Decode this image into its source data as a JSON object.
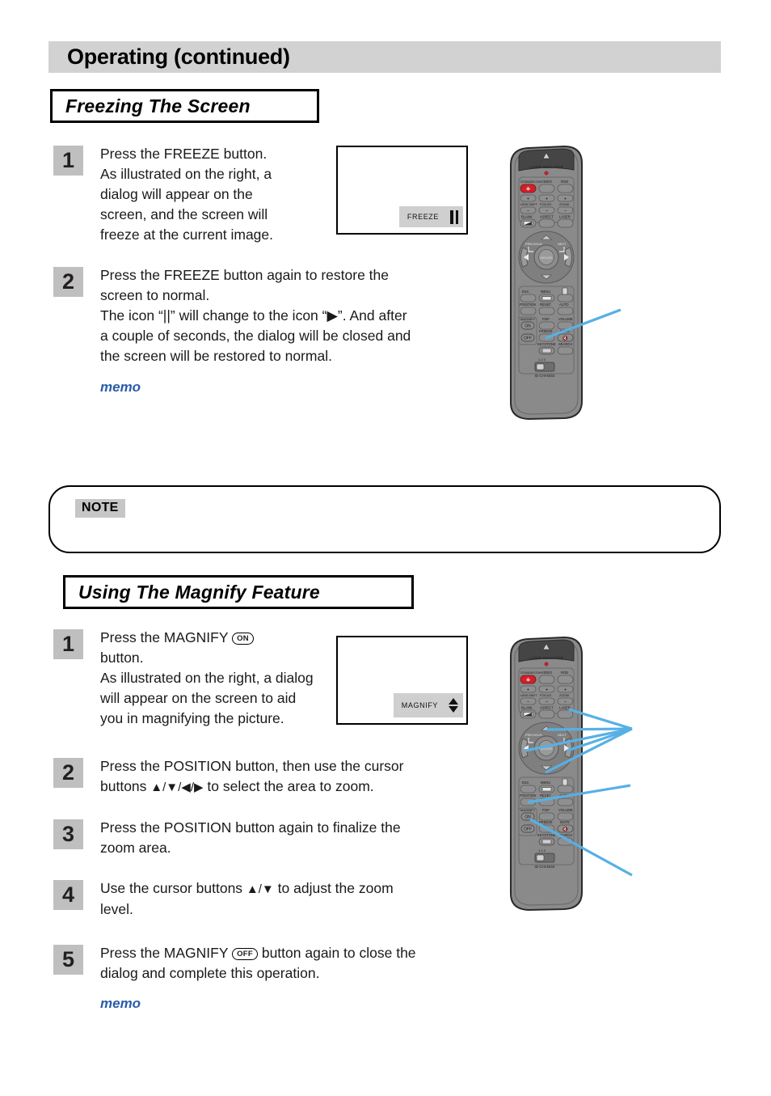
{
  "header": {
    "title": "Operating (continued)"
  },
  "sections": [
    {
      "id": "freeze",
      "title": "Freezing The Screen"
    },
    {
      "id": "magnify",
      "title": "Using The Magnify Feature"
    }
  ],
  "freeze_steps": [
    {
      "num": "1",
      "lines": [
        "Press the FREEZE button.",
        "As illustrated on the right, a",
        "dialog will appear on the",
        "screen, and the screen will",
        "freeze at the current image."
      ]
    },
    {
      "num": "2",
      "lines": [
        "Press the FREEZE button again to restore the",
        "screen to normal.",
        "The icon “||” will change to the icon “▶”.  And after",
        "a couple of seconds, the dialog will be closed and",
        "the screen will be restored to normal."
      ],
      "memo": "memo"
    }
  ],
  "magnify_steps": [
    {
      "num": "1",
      "line1_pre": "Press the MAGNIFY",
      "badge": "ON",
      "lines": [
        "button.",
        "As illustrated on the right, a dialog",
        "will appear on the screen to aid",
        "you in magnifying the picture."
      ]
    },
    {
      "num": "2",
      "line1": "Press the POSITION button, then use the cursor",
      "line2_pre": "buttons ",
      "line2_cursors": "▲/▼/◀/▶",
      "line2_post": " to select the area to zoom."
    },
    {
      "num": "3",
      "lines": [
        "Press the POSITION button again to finalize the",
        "zoom area."
      ]
    },
    {
      "num": "4",
      "line1_pre": "Use the cursor buttons ",
      "line1_cursors": "▲/▼",
      "line1_post": " to adjust the zoom",
      "lines": [
        "level."
      ]
    },
    {
      "num": "5",
      "line1_pre": "Press the MAGNIFY",
      "badge": "OFF",
      "line1_post": " button again to close the",
      "lines": [
        "dialog and complete this operation."
      ],
      "memo": "memo"
    }
  ],
  "note": {
    "label": "NOTE",
    "body": ""
  },
  "osd_freeze": {
    "label": "FREEZE",
    "icon": "pause-icon"
  },
  "osd_magnify": {
    "label": "MAGNIFY",
    "icon": "up-down-arrows-icon"
  },
  "remote": {
    "laser_indicator": "LASER INDICATOR",
    "row_power": [
      "STANDBY/ON",
      "VIDEO",
      "RGB"
    ],
    "row_adjust": [
      "LENS SHIFT",
      "FOCUS",
      "ZOOM"
    ],
    "row_misc": [
      "BLANK",
      "ASPECT",
      "LASER"
    ],
    "nav": {
      "previous": "PREVIOUS",
      "next": "NEXT",
      "center": "MOUSE"
    },
    "row_menu": [
      "ESC",
      "MENU"
    ],
    "row_position": [
      "POSITION",
      "RESET",
      "AUTO"
    ],
    "magnify_group": {
      "label": "MAGNIFY",
      "on": "ON",
      "off": "OFF"
    },
    "row_pinp": [
      "PinP",
      "VOLUME"
    ],
    "row_freeze": [
      "FREEZE",
      "MUTE"
    ],
    "row_keystone": [
      "KEYSTONE",
      "SEARCH"
    ],
    "id_switch": {
      "positions": "1 2 3",
      "label": "ID CHANGE"
    },
    "plus": "+",
    "minus": "−"
  },
  "colors": {
    "header_bg": "#d2d2d2",
    "step_num_bg": "#bfbfbf",
    "memo_blue": "#2a5caa",
    "pointer_blue": "#57b0e5",
    "remote_body": "#8a8a8a",
    "remote_dark": "#4d4d4d",
    "power_red": "#d0202a",
    "osd_bg": "#cfcfcf"
  }
}
